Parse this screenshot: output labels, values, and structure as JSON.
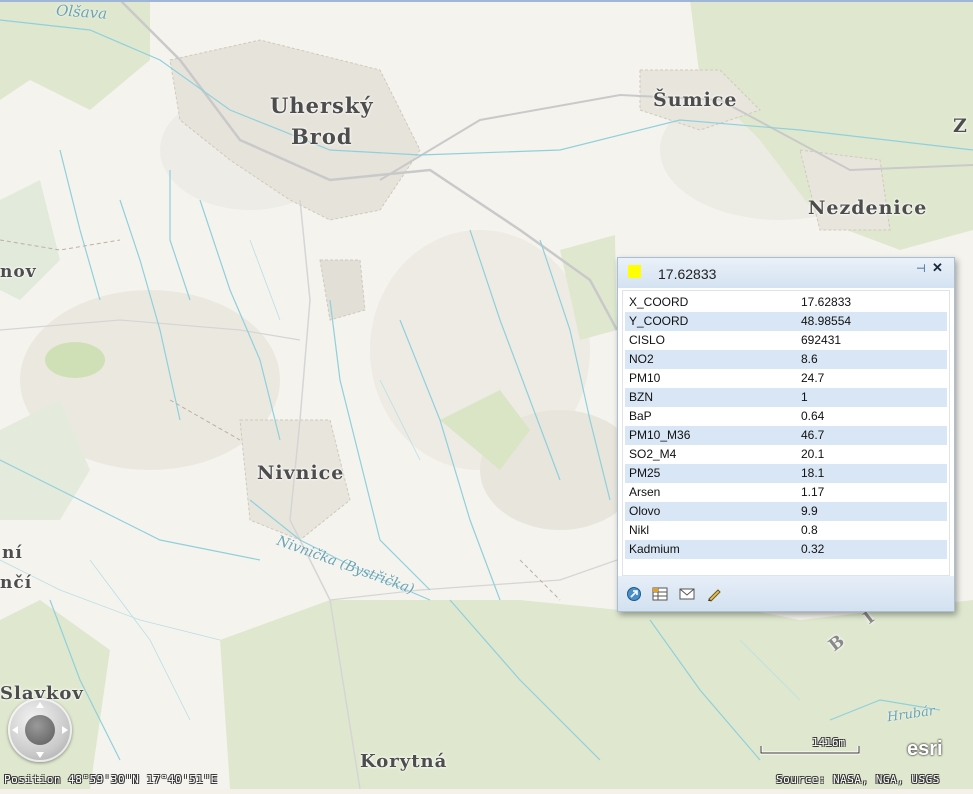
{
  "map": {
    "places": [
      {
        "id": "uhersky",
        "text": "Uherský"
      },
      {
        "id": "brod",
        "text": "Brod"
      },
      {
        "id": "sumice",
        "text": "Šumice"
      },
      {
        "id": "nezdenice",
        "text": "Nezdenice"
      },
      {
        "id": "nivnice",
        "text": "Nivnice"
      },
      {
        "id": "slavkov",
        "text": "Slavkov"
      },
      {
        "id": "korytna",
        "text": "Korytná"
      },
      {
        "id": "z",
        "text": "Z"
      },
      {
        "id": "nov",
        "text": "nov"
      },
      {
        "id": "ni",
        "text": "ní"
      },
      {
        "id": "nci",
        "text": "nčí"
      }
    ],
    "water_labels": [
      {
        "id": "olsava",
        "text": "Olšava"
      },
      {
        "id": "nivnicka",
        "text": "Nivnička (Bystřička)"
      },
      {
        "id": "hrubar",
        "text": "Hrubár"
      }
    ],
    "range_label": "B Í L É"
  },
  "popup": {
    "title": "17.62833",
    "symbol_color": "#ffff00",
    "attributes": [
      {
        "key": "X_COORD",
        "value": "17.62833"
      },
      {
        "key": "Y_COORD",
        "value": "48.98554"
      },
      {
        "key": "CISLO",
        "value": "692431"
      },
      {
        "key": "NO2",
        "value": "8.6"
      },
      {
        "key": "PM10",
        "value": "24.7"
      },
      {
        "key": "BZN",
        "value": "1"
      },
      {
        "key": "BaP",
        "value": "0.64"
      },
      {
        "key": "PM10_M36",
        "value": "46.7"
      },
      {
        "key": "SO2_M4",
        "value": "20.1"
      },
      {
        "key": "PM25",
        "value": "18.1"
      },
      {
        "key": "Arsen",
        "value": "1.17"
      },
      {
        "key": "Olovo",
        "value": "9.9"
      },
      {
        "key": "Nikl",
        "value": "0.8"
      },
      {
        "key": "Kadmium",
        "value": "0.32"
      }
    ],
    "footer_icons": [
      "zoom-to-icon",
      "table-icon",
      "email-icon",
      "edit-pencil-icon"
    ]
  },
  "status": {
    "position": "Position 48°59'30\"N  17°40'51\"E",
    "scale": "1416m",
    "source": "Source: NASA, NGA, USGS",
    "logo": "esri"
  },
  "colors": {
    "background": "#f3f1ea",
    "forest": "#dfe8cf",
    "stream": "#8fd0dc",
    "road": "#c9c9c9",
    "popup_header": "#d4e2f1",
    "row_alt": "#d9e6f5"
  }
}
